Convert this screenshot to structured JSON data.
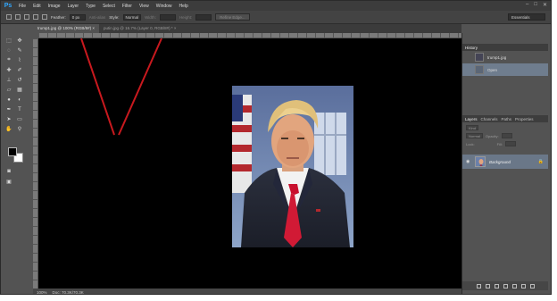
{
  "app": {
    "logo": "Ps"
  },
  "menu": [
    "File",
    "Edit",
    "Image",
    "Layer",
    "Type",
    "Select",
    "Filter",
    "View",
    "Window",
    "Help"
  ],
  "window_controls": [
    "–",
    "□",
    "✕"
  ],
  "options_bar": {
    "feather_label": "Feather:",
    "feather_value": "0 px",
    "anti_alias_label": "Anti-alias",
    "style_label": "Style:",
    "style_value": "Normal",
    "width_label": "Width:",
    "height_label": "Height:",
    "refine_edge_label": "Refine Edge...",
    "workspace": "Essentials"
  },
  "tabs": [
    {
      "label": "trump1.jpg @ 100% (RGB/8#) ×",
      "active": true
    },
    {
      "label": "putin.jpg @ 16.7% (Layer 0, RGB/8#) * ×",
      "active": false
    }
  ],
  "status": {
    "zoom": "100%",
    "doc": "Doc: 70.3K/70.3K"
  },
  "history_panel": {
    "title": "History",
    "snapshot_name": "trump1.jpg",
    "items": [
      "Open"
    ]
  },
  "layers_panel": {
    "tabs": [
      "Layers",
      "Channels",
      "Paths",
      "Properties"
    ],
    "kind_label": "Kind",
    "blend_mode": "Normal",
    "opacity_label": "Opacity:",
    "lock_label": "Lock:",
    "fill_label": "Fill:",
    "layers": [
      {
        "name": "Background",
        "locked": true
      }
    ]
  },
  "colors": {
    "accent": "#31a8ff",
    "annotation": "#c8191e",
    "selected_row": "#6f7d8e"
  }
}
